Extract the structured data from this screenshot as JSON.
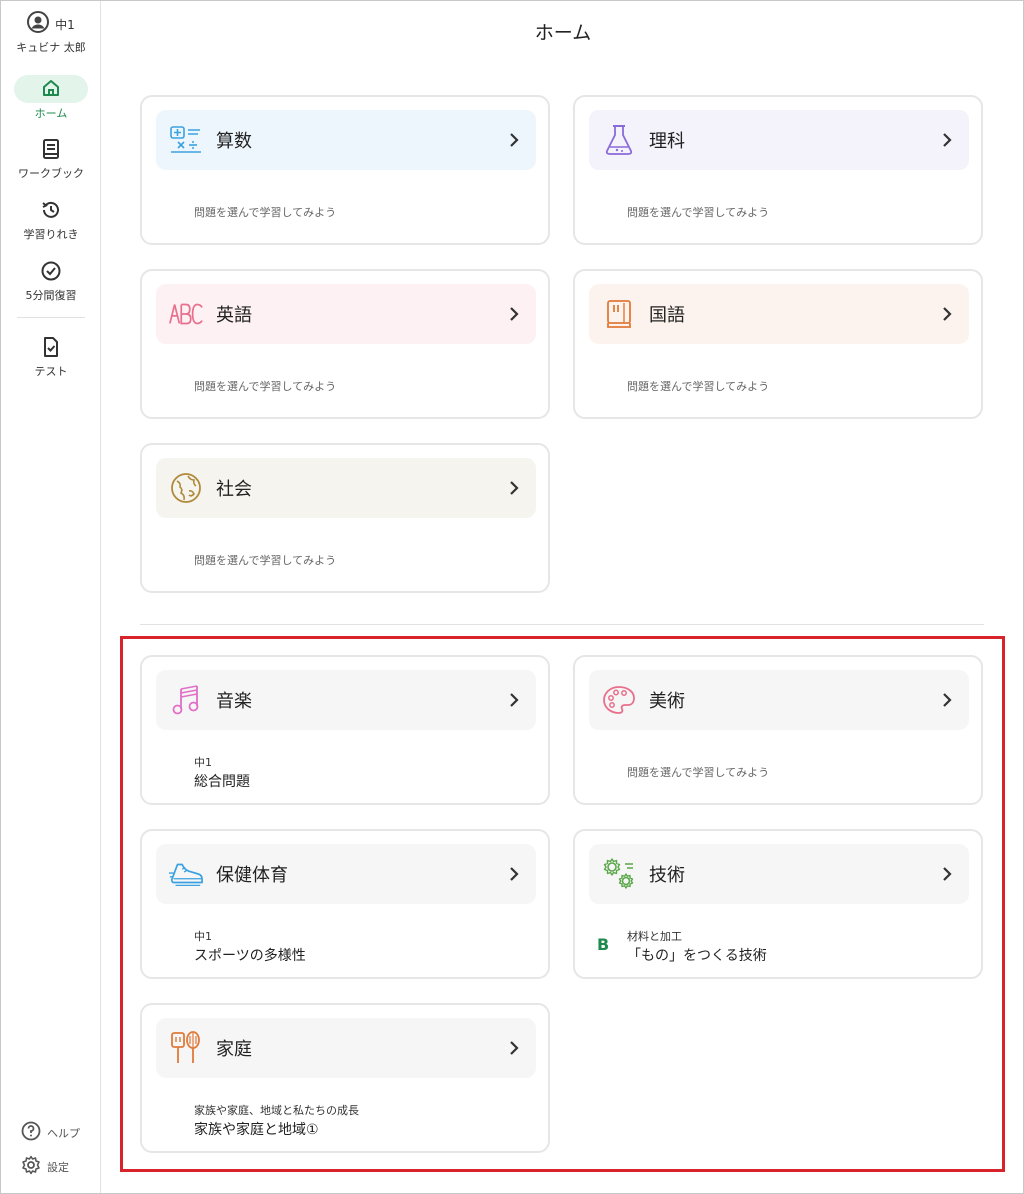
{
  "user": {
    "grade": "中1",
    "name": "キュビナ 太郎"
  },
  "nav": [
    {
      "label": "ホーム",
      "icon": "home-icon",
      "active": true
    },
    {
      "label": "ワークブック",
      "icon": "book-icon"
    },
    {
      "label": "学習りれき",
      "icon": "history-icon"
    },
    {
      "label": "5分間復習",
      "icon": "check-circle-icon"
    },
    {
      "label": "テスト",
      "icon": "test-file-icon"
    }
  ],
  "footer": {
    "help": "ヘルプ",
    "settings": "設定"
  },
  "page": {
    "title": "ホーム"
  },
  "subjects": [
    {
      "name": "算数",
      "icon": "math-icon",
      "hint": "問題を選んで学習してみよう",
      "bg": "#eef6fd"
    },
    {
      "name": "理科",
      "icon": "flask-icon",
      "hint": "問題を選んで学習してみよう",
      "bg": "#f4f2fb"
    },
    {
      "name": "英語",
      "icon": "abc-icon",
      "hint": "問題を選んで学習してみよう",
      "bg": "#fdf1f4"
    },
    {
      "name": "国語",
      "icon": "japanese-book-icon",
      "hint": "問題を選んで学習してみよう",
      "bg": "#fdf3ee"
    },
    {
      "name": "社会",
      "icon": "globe-icon",
      "hint": "問題を選んで学習してみよう",
      "bg": "#f5f4ef"
    },
    {
      "name": "音楽",
      "icon": "music-note-icon",
      "small": "中1",
      "big": "総合問題",
      "bg": "#f6f6f6"
    },
    {
      "name": "美術",
      "icon": "palette-icon",
      "hint": "問題を選んで学習してみよう",
      "bg": "#f6f6f6"
    },
    {
      "name": "保健体育",
      "icon": "sneaker-icon",
      "small": "中1",
      "big": "スポーツの多様性",
      "bg": "#f6f6f6"
    },
    {
      "name": "技術",
      "icon": "gears-icon",
      "badge": "B",
      "small": "材料と加工",
      "big": "「もの」をつくる技術",
      "bg": "#f6f6f6"
    },
    {
      "name": "家庭",
      "icon": "kitchen-tools-icon",
      "small": "家族や家庭、地域と私たちの成長",
      "big": "家族や家庭と地域①",
      "bg": "#f6f6f6"
    }
  ],
  "colors": {
    "accent": "#1e8a4e",
    "highlight": "#d9232a"
  }
}
